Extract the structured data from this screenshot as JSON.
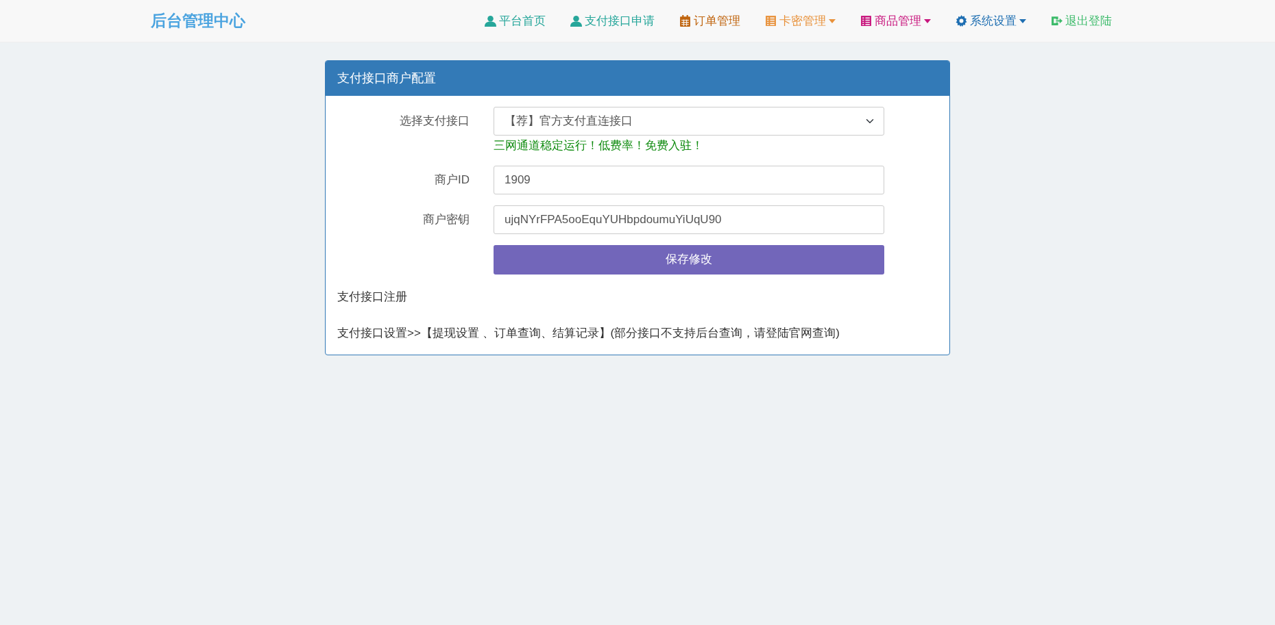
{
  "navbar": {
    "brand": "后台管理中心",
    "items": [
      {
        "label": "平台首页",
        "kind": "user",
        "color": "#26a69a",
        "dropdown": false
      },
      {
        "label": "支付接口申请",
        "kind": "user",
        "color": "#26a69a",
        "dropdown": false
      },
      {
        "label": "订单管理",
        "kind": "calendar",
        "color": "#c0650f",
        "dropdown": false
      },
      {
        "label": "卡密管理",
        "kind": "list",
        "color": "#e8923c",
        "dropdown": true
      },
      {
        "label": "商品管理",
        "kind": "list",
        "color": "#c8177e",
        "dropdown": true
      },
      {
        "label": "系统设置",
        "kind": "gear",
        "color": "#1f6fb2",
        "dropdown": true
      },
      {
        "label": "退出登陆",
        "kind": "logout",
        "color": "#3dbb6b",
        "dropdown": false
      }
    ]
  },
  "panel": {
    "title": "支付接口商户配置",
    "fields": [
      {
        "kind": "select",
        "label": "选择支付接口",
        "value": "【荐】官方支付直连接口",
        "help": "三网通道稳定运行！低费率！免费入驻！"
      },
      {
        "kind": "text",
        "label": "商户ID",
        "value": "1909"
      },
      {
        "kind": "text",
        "label": "商户密钥",
        "value": "ujqNYrFPA5ooEquYUHbpdoumuYiUqU90"
      }
    ],
    "button": "保存修改",
    "notes": [
      "支付接口注册",
      "支付接口设置>>【提现设置 、订单查询、结算记录】(部分接口不支持后台查询，请登陆官网查询)"
    ]
  }
}
